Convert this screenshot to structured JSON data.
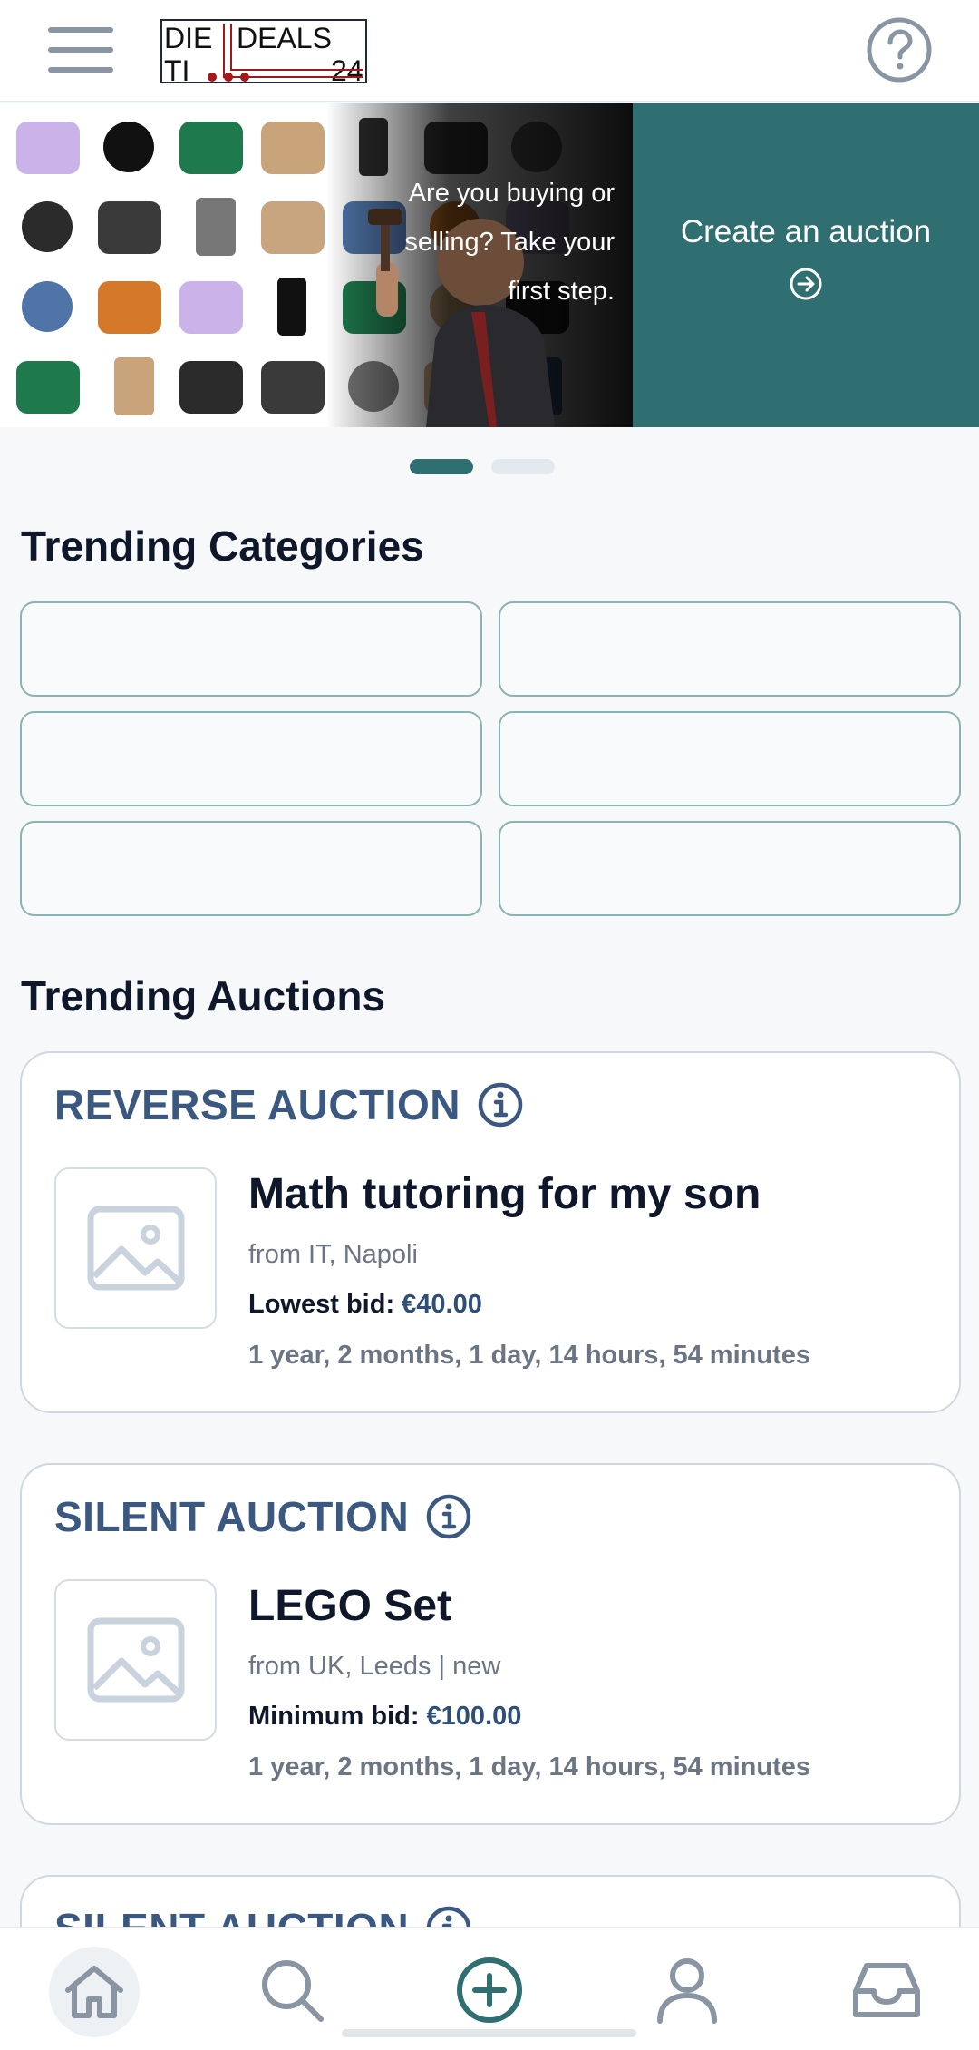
{
  "app": {
    "logo_text": [
      "DIE",
      "DEALS",
      "TI",
      "24"
    ]
  },
  "header": {
    "menu_icon": "hamburger-icon",
    "help_icon": "question-circle-icon"
  },
  "banner": {
    "tagline": "Are you buying or selling? Take your first step.",
    "cta_label": "Create an auction",
    "cta_icon": "arrow-right-circle-icon",
    "slides": 2,
    "active_slide": 1
  },
  "sections": {
    "categories_title": "Trending Categories",
    "auctions_title": "Trending Auctions"
  },
  "categories": [
    "",
    "",
    "",
    "",
    "",
    ""
  ],
  "auctions": [
    {
      "type": "REVERSE AUCTION",
      "title": "Math tutoring for my son",
      "from": "from IT, Napoli",
      "bid_label": "Lowest bid: ",
      "bid_amount": "€40.00",
      "time_left": "1 year, 2 months, 1 day, 14 hours, 54 minutes"
    },
    {
      "type": "SILENT AUCTION",
      "title": "LEGO Set",
      "from": "from UK, Leeds | new",
      "bid_label": "Minimum bid: ",
      "bid_amount": "€100.00",
      "time_left": "1 year, 2 months, 1 day, 14 hours, 54 minutes"
    },
    {
      "type": "SILENT AUCTION"
    }
  ],
  "bottom_nav": [
    {
      "icon": "home-icon",
      "active": true
    },
    {
      "icon": "search-icon",
      "active": false
    },
    {
      "icon": "plus-circle-icon",
      "active": false
    },
    {
      "icon": "user-icon",
      "active": false
    },
    {
      "icon": "inbox-icon",
      "active": false
    }
  ],
  "colors": {
    "accent": "#2f6f72",
    "auction_type": "#3a5880",
    "bid_amount": "#2e4f77",
    "muted_text": "#6b7583",
    "icon_gray": "#8a95a3"
  }
}
